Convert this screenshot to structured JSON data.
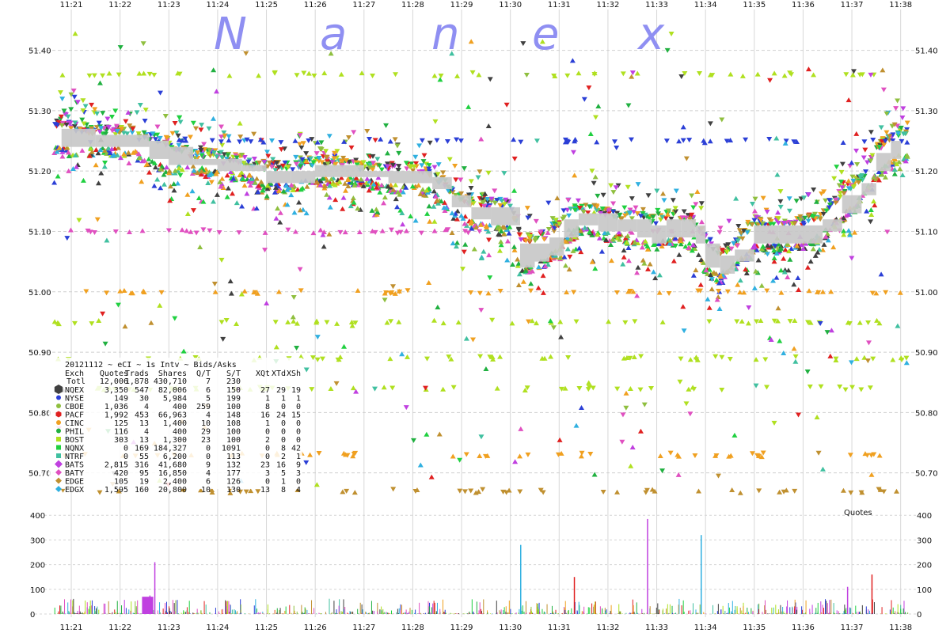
{
  "watermark": [
    "N",
    "a",
    "n",
    "e",
    "x"
  ],
  "header": "20121112 ~ eCI ~ 1s Intv ~ Bids/Asks",
  "volume_label": "Quotes",
  "stats_table": {
    "columns": [
      "Exch",
      "Quotes",
      "Trads",
      "Shares",
      "Q/T",
      "S/T",
      "XQt",
      "XTd",
      "XSh"
    ],
    "total": [
      "Totl",
      "12,006",
      "1,878",
      "430,710",
      "7",
      "230",
      "",
      "",
      ""
    ],
    "rows": [
      {
        "exch": "NQEX",
        "color": "#404040",
        "marker": "hexagon",
        "cells": [
          "3,350",
          "547",
          "82,006",
          "6",
          "150",
          "27",
          "29",
          "19"
        ]
      },
      {
        "exch": "NYSE",
        "color": "#2b3fd6",
        "marker": "circle",
        "cells": [
          "149",
          "30",
          "5,984",
          "5",
          "199",
          "1",
          "1",
          "1"
        ]
      },
      {
        "exch": "CBOE",
        "color": "#8fbf3f",
        "marker": "circle",
        "cells": [
          "1,036",
          "4",
          "400",
          "259",
          "100",
          "8",
          "0",
          "0"
        ]
      },
      {
        "exch": "PACF",
        "color": "#e02020",
        "marker": "hexagon",
        "cells": [
          "1,992",
          "453",
          "66,963",
          "4",
          "148",
          "16",
          "24",
          "15"
        ]
      },
      {
        "exch": "CINC",
        "color": "#f0a020",
        "marker": "circle",
        "cells": [
          "125",
          "13",
          "1,400",
          "10",
          "108",
          "1",
          "0",
          "0"
        ]
      },
      {
        "exch": "PHIL",
        "color": "#20b040",
        "marker": "circle",
        "cells": [
          "116",
          "4",
          "400",
          "29",
          "100",
          "0",
          "0",
          "0"
        ]
      },
      {
        "exch": "BOST",
        "color": "#b0e020",
        "marker": "square",
        "cells": [
          "303",
          "13",
          "1,300",
          "23",
          "100",
          "2",
          "0",
          "0"
        ]
      },
      {
        "exch": "NQNX",
        "color": "#20d040",
        "marker": "square",
        "cells": [
          "0",
          "169",
          "184,327",
          "0",
          "1091",
          "0",
          "8",
          "42"
        ]
      },
      {
        "exch": "NTRF",
        "color": "#40c0a0",
        "marker": "square",
        "cells": [
          "0",
          "55",
          "6,200",
          "0",
          "113",
          "0",
          "2",
          "1"
        ]
      },
      {
        "exch": "BATS",
        "color": "#c040e0",
        "marker": "diamond",
        "cells": [
          "2,815",
          "316",
          "41,680",
          "9",
          "132",
          "23",
          "16",
          "9"
        ]
      },
      {
        "exch": "BATY",
        "color": "#e050c0",
        "marker": "diamond",
        "cells": [
          "420",
          "95",
          "16,850",
          "4",
          "177",
          "3",
          "5",
          "3"
        ]
      },
      {
        "exch": "EDGE",
        "color": "#c09030",
        "marker": "diamond",
        "cells": [
          "105",
          "19",
          "2,400",
          "6",
          "126",
          "0",
          "1",
          "0"
        ]
      },
      {
        "exch": "EDGX",
        "color": "#30b0e0",
        "marker": "diamond",
        "cells": [
          "1,595",
          "160",
          "20,800",
          "10",
          "130",
          "13",
          "8",
          "4"
        ]
      }
    ]
  },
  "chart_data": [
    {
      "type": "scatter",
      "title": "",
      "xlabel": "",
      "ylabel": "",
      "x_ticks": [
        "11:21",
        "11:22",
        "11:23",
        "11:24",
        "11:25",
        "11:26",
        "11:27",
        "11:28",
        "11:29",
        "11:30",
        "11:31",
        "11:32",
        "11:33",
        "11:34",
        "11:35",
        "11:36",
        "11:37",
        "11:38"
      ],
      "y_ticks": [
        51.4,
        51.3,
        51.2,
        51.1,
        51.0,
        50.9,
        50.8,
        50.7
      ],
      "ylim": [
        50.655,
        51.465
      ],
      "grid": true,
      "series": [
        {
          "name": "NBBO",
          "color": "#c8c8c8",
          "x": [
            "11:20.8",
            "11:21.5",
            "11:22.2",
            "11:22.6",
            "11:23.0",
            "11:23.5",
            "11:24.0",
            "11:24.5",
            "11:25.0",
            "11:25.5",
            "11:26.0",
            "11:26.5",
            "11:27.0",
            "11:27.5",
            "11:28.0",
            "11:28.4",
            "11:28.8",
            "11:29.2",
            "11:29.6",
            "11:30.0",
            "11:30.2",
            "11:30.5",
            "11:30.8",
            "11:31.1",
            "11:31.4",
            "11:31.8",
            "11:32.2",
            "11:32.6",
            "11:32.9",
            "11:33.2",
            "11:33.5",
            "11:33.8",
            "11:34.0",
            "11:34.3",
            "11:34.6",
            "11:35.0",
            "11:35.5",
            "11:36.0",
            "11:36.4",
            "11:36.8",
            "11:37.2",
            "11:37.5",
            "11:37.8",
            "11:38.0"
          ],
          "bid": [
            51.24,
            51.24,
            51.24,
            51.22,
            51.21,
            51.21,
            51.2,
            51.2,
            51.18,
            51.18,
            51.19,
            51.19,
            51.19,
            51.18,
            51.18,
            51.17,
            51.14,
            51.12,
            51.11,
            51.11,
            51.04,
            51.05,
            51.06,
            51.09,
            51.11,
            51.1,
            51.1,
            51.09,
            51.08,
            51.09,
            51.09,
            51.08,
            51.04,
            51.03,
            51.05,
            51.08,
            51.08,
            51.08,
            51.1,
            51.13,
            51.16,
            51.2,
            51.22,
            51.23
          ],
          "ask": [
            51.27,
            51.26,
            51.26,
            51.25,
            51.24,
            51.22,
            51.22,
            51.21,
            51.2,
            51.2,
            51.21,
            51.21,
            51.2,
            51.2,
            51.2,
            51.19,
            51.16,
            51.14,
            51.14,
            51.14,
            51.08,
            51.08,
            51.09,
            51.12,
            51.13,
            51.13,
            51.12,
            51.12,
            51.11,
            51.12,
            51.12,
            51.11,
            51.08,
            51.06,
            51.07,
            51.11,
            51.11,
            51.11,
            51.12,
            51.16,
            51.18,
            51.23,
            51.25,
            51.26
          ]
        }
      ],
      "notes": "Dense bid/ask quote triangles per exchange; colors per stats_table."
    },
    {
      "type": "bar",
      "title": "",
      "ylabel": "Quotes",
      "x_ticks": [
        "11:21",
        "11:22",
        "11:23",
        "11:24",
        "11:25",
        "11:26",
        "11:27",
        "11:28",
        "11:29",
        "11:30",
        "11:31",
        "11:32",
        "11:33",
        "11:34",
        "11:35",
        "11:36",
        "11:37",
        "11:38"
      ],
      "y_ticks": [
        400,
        300,
        200,
        100,
        0
      ],
      "ylim": [
        0,
        420
      ],
      "spikes": [
        {
          "x": "11:22.7",
          "value": 210,
          "color": "#c040e0"
        },
        {
          "x": "11:22.6",
          "value": 75,
          "color": "#c040e0"
        },
        {
          "x": "11:30.2",
          "value": 280,
          "color": "#30b0e0"
        },
        {
          "x": "11:32.8",
          "value": 385,
          "color": "#c040e0"
        },
        {
          "x": "11:33.9",
          "value": 320,
          "color": "#30b0e0"
        },
        {
          "x": "11:31.3",
          "value": 150,
          "color": "#e02020"
        },
        {
          "x": "11:37.4",
          "value": 160,
          "color": "#e02020"
        },
        {
          "x": "11:36.9",
          "value": 110,
          "color": "#c040e0"
        }
      ]
    }
  ]
}
